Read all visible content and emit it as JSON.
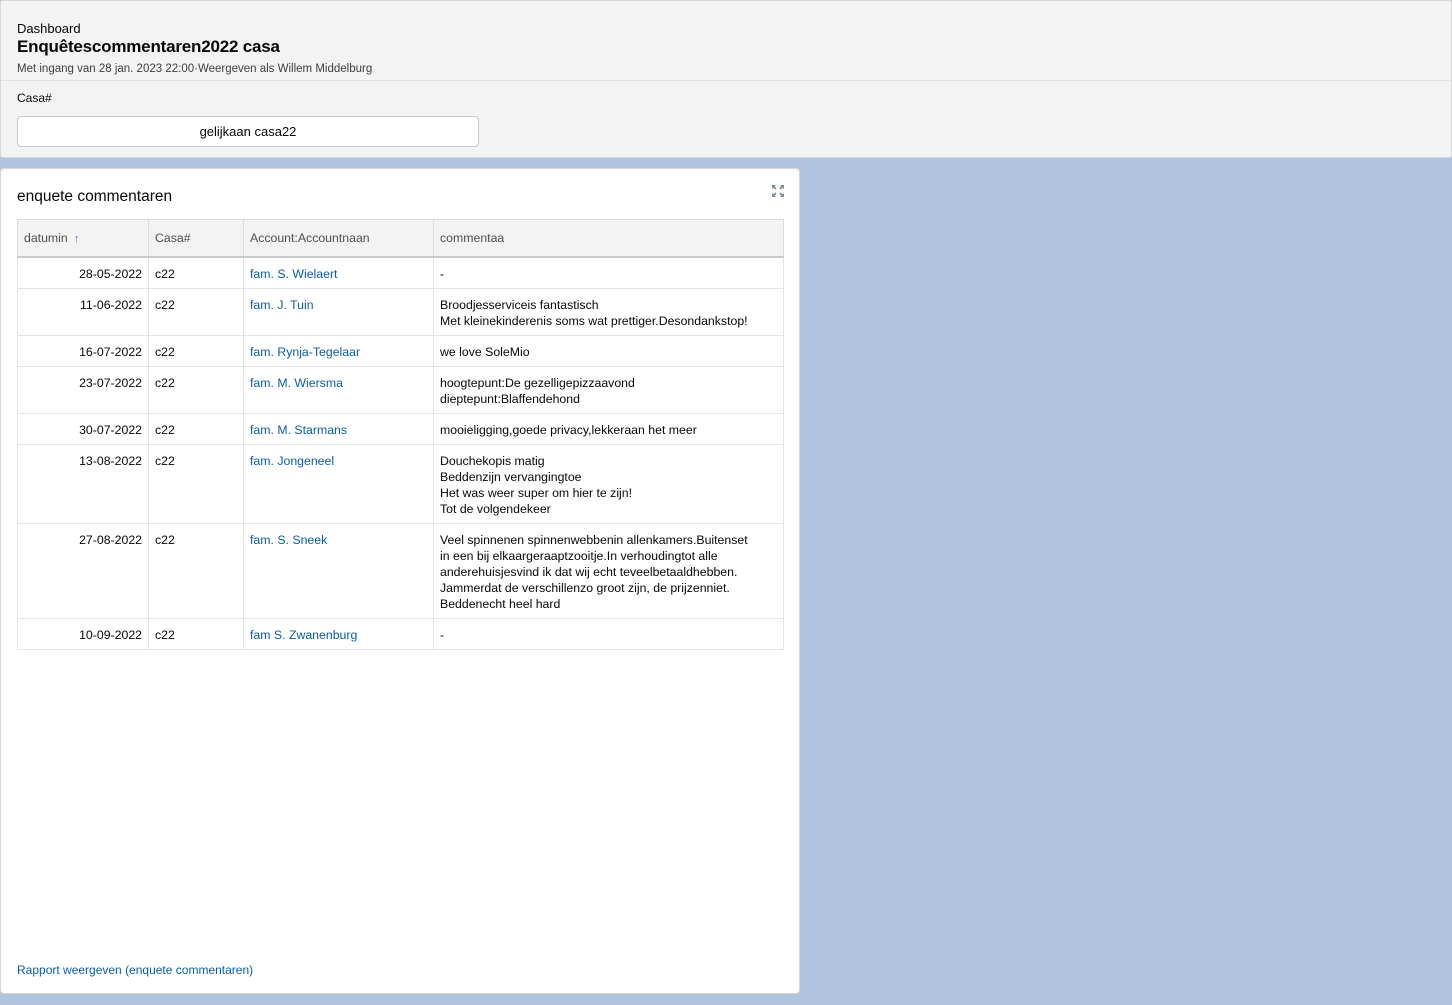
{
  "header": {
    "eyebrow": "Dashboard",
    "title": "Enquêtescommentaren2022 casa",
    "subtitle": "Met ingang van 28 jan. 2023 22:00·Weergeven als Willem Middelburg",
    "filter_label": "Casa#",
    "filter_value": "gelijkaan casa22"
  },
  "card": {
    "title": "enquete commentaren",
    "expand_icon": "expand-icon",
    "footer_link": "Rapport weergeven (enquete commentaren)"
  },
  "table": {
    "columns": [
      "datumin",
      "Casa#",
      "Account:Accountnaan",
      "commentaa"
    ],
    "sort_icon": "↑",
    "rows": [
      {
        "date": "28-05-2022",
        "casa": "c22",
        "account": "fam. S. Wielaert",
        "comment": [
          "-"
        ]
      },
      {
        "date": "11-06-2022",
        "casa": "c22",
        "account": "fam. J. Tuin",
        "comment": [
          "Broodjesserviceis fantastisch",
          "Met kleinekinderenis soms wat prettiger.Desondankstop!"
        ]
      },
      {
        "date": "16-07-2022",
        "casa": "c22",
        "account": "fam. Rynja-Tegelaar",
        "comment": [
          "we love SoleMio"
        ]
      },
      {
        "date": "23-07-2022",
        "casa": "c22",
        "account": "fam. M. Wiersma",
        "comment": [
          "hoogtepunt:De gezelligepizzaavond",
          "dieptepunt:Blaffendehond"
        ]
      },
      {
        "date": "30-07-2022",
        "casa": "c22",
        "account": "fam. M. Starmans",
        "comment": [
          "mooieligging,goede privacy,lekkeraan het meer"
        ]
      },
      {
        "date": "13-08-2022",
        "casa": "c22",
        "account": "fam. Jongeneel",
        "comment": [
          "Douchekopis matig",
          "Beddenzijn vervangingtoe",
          "Het was weer super om hier te zijn!",
          "Tot de volgendekeer"
        ]
      },
      {
        "date": "27-08-2022",
        "casa": "c22",
        "account": "fam. S. Sneek",
        "comment": [
          "Veel spinnenen spinnenwebbenin allenkamers.Buitenset",
          "in een bij elkaargeraaptzooitje.In verhoudingtot alle",
          "anderehuisjesvind ik dat wij echt teveelbetaaldhebben.",
          "Jammerdat de verschillenzo groot zijn, de prijzenniet.",
          "Beddenecht heel hard"
        ]
      },
      {
        "date": "10-09-2022",
        "casa": "c22",
        "account": "fam S. Zwanenburg",
        "comment": [
          "-"
        ]
      }
    ]
  },
  "colors": {
    "background": "#b0c4de",
    "link": "#0b5cab",
    "header_bg": "#f3f3f3"
  }
}
